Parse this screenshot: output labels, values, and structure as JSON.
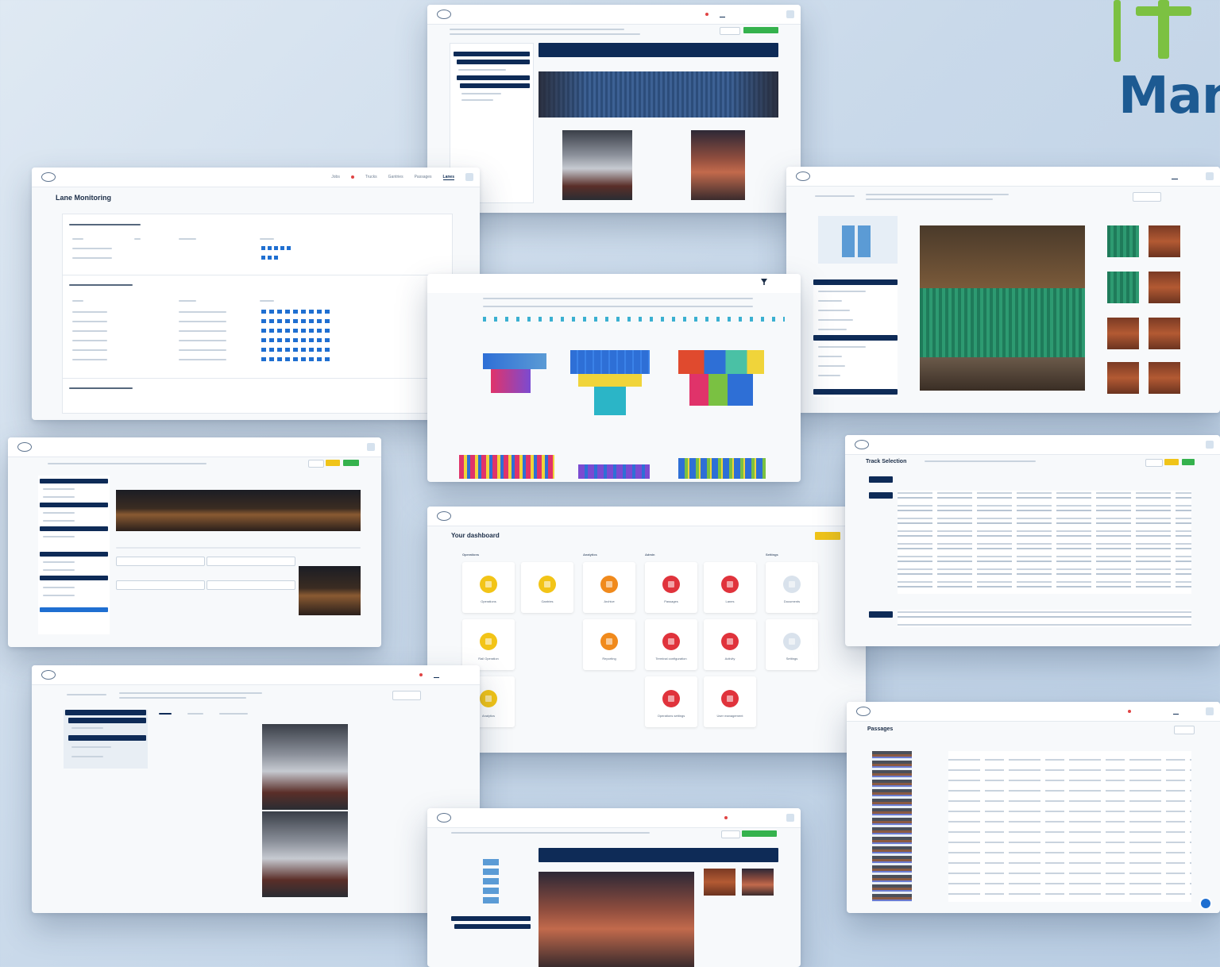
{
  "brand": {
    "text": "Mana"
  },
  "lane_monitoring": {
    "title": "Lane Monitoring",
    "nav": [
      "Jobs",
      "Trucks",
      "Gantries",
      "Passages",
      "Lanes"
    ]
  },
  "dashboard": {
    "title": "Your dashboard",
    "sections": [
      "Operations",
      "Analytics",
      "Admin",
      "Settings"
    ],
    "tiles": [
      "Operations",
      "Gantries",
      "Archive",
      "Passages",
      "Lanes",
      "Documents",
      "Rail Operation",
      "Reporting",
      "Terminal configuration",
      "Activity",
      "Settings",
      "Analytics",
      "Operations settings",
      "User management"
    ]
  },
  "track_selection": {
    "title": "Track Selection"
  },
  "passages": {
    "title": "Passages"
  },
  "colors": {
    "navy": "#0e2b57",
    "green": "#35b24d",
    "yellow": "#f0c419",
    "orange": "#f08a1c",
    "red": "#e0333c",
    "brand": "#1d5a92",
    "brand_green": "#7cc142"
  }
}
